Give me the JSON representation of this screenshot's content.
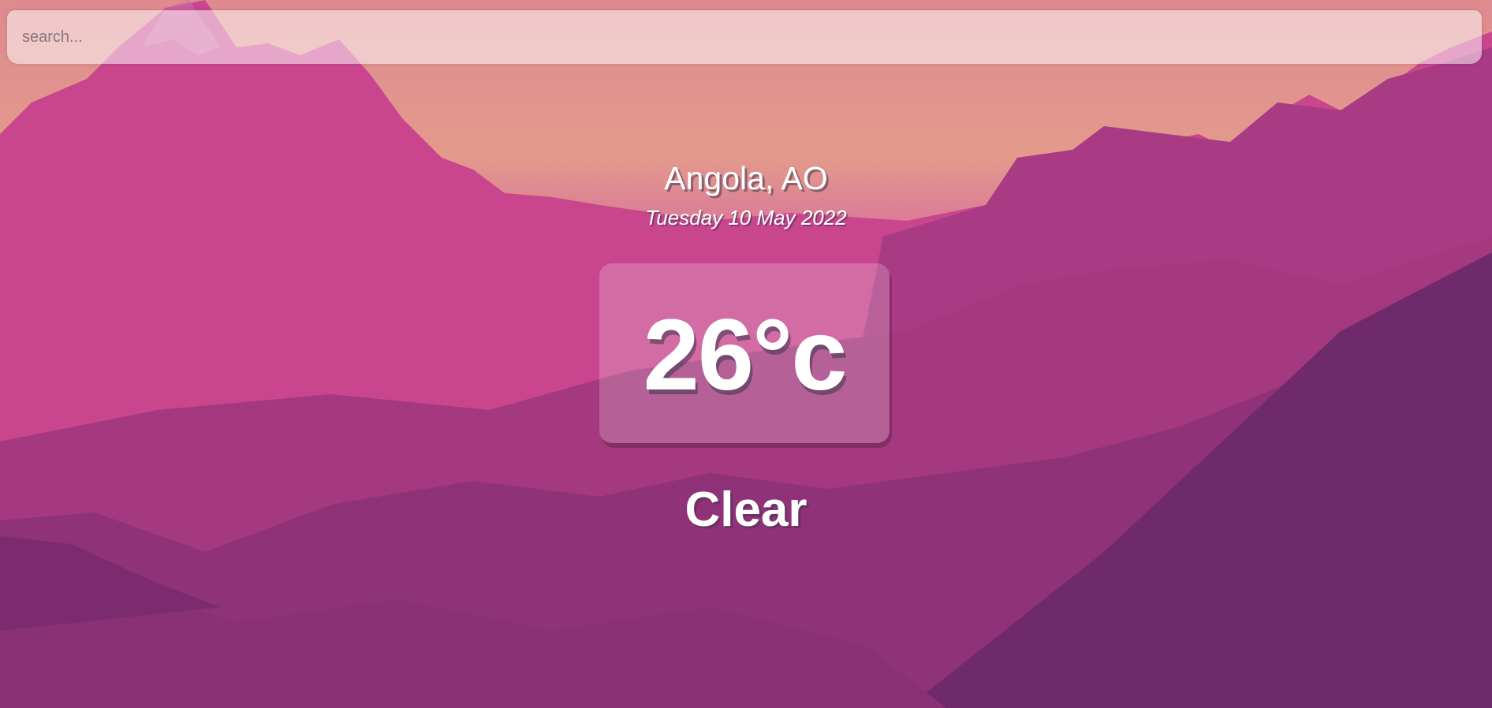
{
  "search": {
    "placeholder": "search...",
    "value": ""
  },
  "location": {
    "city": "Angola, AO",
    "date": "Tuesday 10 May 2022"
  },
  "weather": {
    "temperature": "26°c",
    "condition": "Clear"
  },
  "colors": {
    "sky_top": "#de8a8f",
    "sky_glow": "#e39a8c",
    "mountain_pink": "#c44a8e",
    "mountain_purple": "#7a2d70",
    "text": "#ffffff"
  }
}
